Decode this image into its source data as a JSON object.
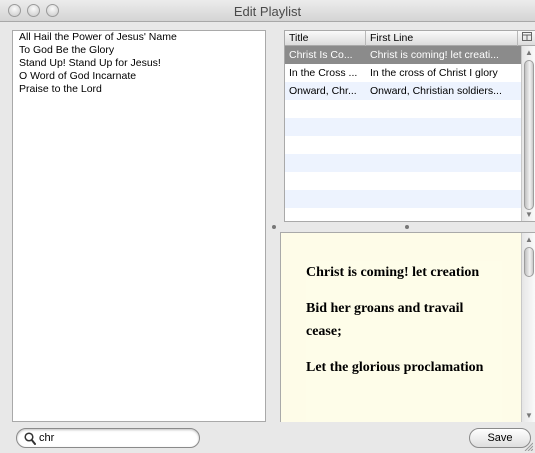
{
  "window": {
    "title": "Edit Playlist"
  },
  "playlist": {
    "items": [
      "All Hail the Power of Jesus' Name",
      "To God Be the Glory",
      "Stand Up! Stand Up for Jesus!",
      "O Word of God Incarnate",
      "Praise to the Lord"
    ]
  },
  "results": {
    "columns": [
      "Title",
      "First Line"
    ],
    "rows": [
      {
        "title": "Christ Is Co...",
        "first_line": "Christ is coming! let creati...",
        "selected": true
      },
      {
        "title": "In the Cross ...",
        "first_line": "In the cross of Christ I glory",
        "selected": false
      },
      {
        "title": "Onward, Chr...",
        "first_line": "Onward, Christian soldiers...",
        "selected": false
      }
    ]
  },
  "preview": {
    "lines": [
      "Christ is coming! let creation",
      "Bid her groans and travail cease;",
      "Let the glorious proclamation"
    ]
  },
  "search": {
    "value": "chr"
  },
  "save_label": "Save",
  "icons": {
    "column-picker": "column-picker-icon",
    "search": "search-icon",
    "resize": "resize-grip-icon"
  },
  "colors": {
    "selection": "#8b8b8b",
    "row_stripe": "#edf3fe",
    "preview_bg": "#fefce8"
  }
}
